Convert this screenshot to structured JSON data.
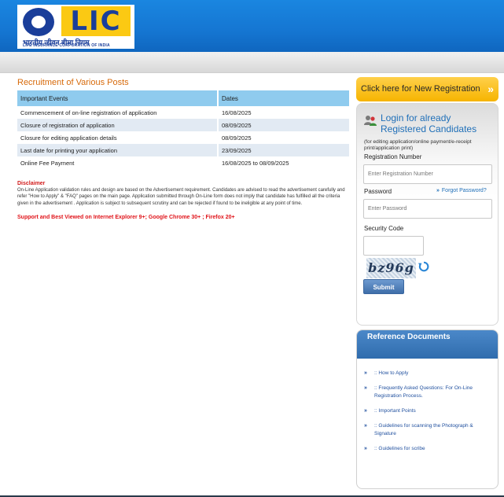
{
  "logo": {
    "brand": "LIC",
    "hindi": "भारतीय जीवन बीमा निगम",
    "subtitle": "LIFE INSURANCE CORPORATION OF INDIA"
  },
  "main": {
    "title": "Recruitment of Various Posts",
    "table": {
      "headers": [
        "Important Events",
        "Dates"
      ],
      "rows": [
        {
          "event": "Commencement of on-line registration of application",
          "date": "16/08/2025"
        },
        {
          "event": "Closure of registration of application",
          "date": "08/09/2025"
        },
        {
          "event": "Closure for editing application details",
          "date": "08/09/2025"
        },
        {
          "event": "Last date for printing your application",
          "date": "23/09/2025"
        },
        {
          "event": "Online Fee Payment",
          "date": "16/08/2025 to 08/09/2025"
        }
      ]
    },
    "disclaimer_title": "Disclaimer",
    "disclaimer_text": "On-Line Application validation rules and design are based on the Advertisement requirement. Candidates are advised to read the advertisement carefully and refer \"How to Apply\" & \"FAQ\" pages on the main page. Application submitted through On-Line form does not imply that candidate has fulfilled all the criteria given in the advertisement . Application is subject to subsequent scrutiny and can be rejected if found to be ineligible at any point of time.",
    "support_text": "Support and Best Viewed on Internet Explorer 9+; Google Chrome 30+ ; Firefox 20+"
  },
  "sidebar": {
    "new_registration": "Click here for New Registration",
    "new_registration_chevron": "»",
    "login_title": "Login for already Registered Candidates",
    "login_note": "(for editing application/online payment/e-receipt print/application print)",
    "reg_label": "Registration Number",
    "reg_placeholder": "Enter Registration Number",
    "password_label": "Password",
    "forgot_label": "Forgot Password?",
    "forgot_arrow": "»",
    "password_placeholder": "Enter Password",
    "security_label": "Security Code",
    "captcha_text": "bz96g",
    "submit_label": "Submit"
  },
  "reference": {
    "title": "Reference Documents",
    "bullet": "»",
    "items": [
      ":: How to Apply",
      ":: Frequently Asked Questions: For On-Line Registration Process.",
      ":: Important Points",
      ":: Guidelines for scanning the Photograph & Signature",
      ":: Guidelines for scribe"
    ]
  },
  "colors": {
    "header_blue": "#1576d2",
    "title_orange": "#d76a0b",
    "table_header": "#8fcbee",
    "link_blue": "#1f6fb8",
    "warning_red": "#e0141a",
    "button_yellow": "#f6b400"
  },
  "icons": {
    "login": "users-icon",
    "refresh": "refresh-icon",
    "emblem": "lic-emblem-icon"
  }
}
